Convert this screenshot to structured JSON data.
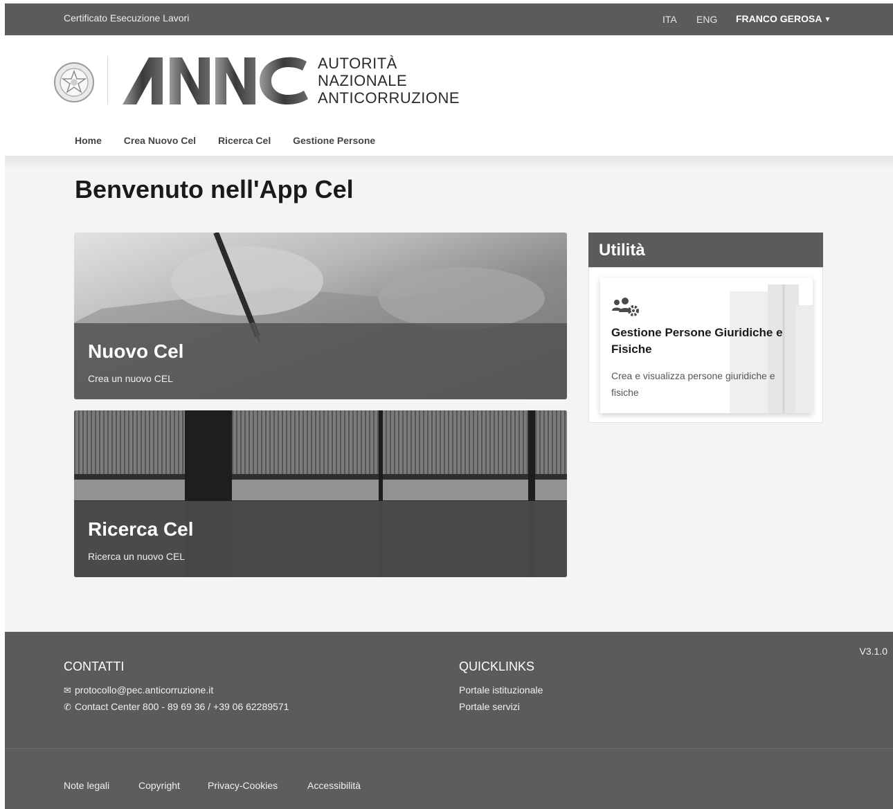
{
  "topbar": {
    "app_name": "Certificato Esecuzione Lavori",
    "lang_ita": "ITA",
    "lang_eng": "ENG",
    "user_name": "FRANCO GEROSA"
  },
  "header": {
    "logo_text": "ANAC",
    "org_line1": "AUTORITÀ",
    "org_line2": "NAZIONALE",
    "org_line3": "ANTICORRUZIONE"
  },
  "nav": {
    "items": [
      {
        "label": "Home"
      },
      {
        "label": "Crea Nuovo Cel"
      },
      {
        "label": "Ricerca Cel"
      },
      {
        "label": "Gestione Persone"
      }
    ]
  },
  "main": {
    "title": "Benvenuto nell'App Cel",
    "cards": [
      {
        "title": "Nuovo Cel",
        "subtitle": "Crea un nuovo CEL"
      },
      {
        "title": "Ricerca Cel",
        "subtitle": "Ricerca un nuovo CEL"
      }
    ]
  },
  "utilita": {
    "heading": "Utilità",
    "card": {
      "icon": "users-gear-icon",
      "title": "Gestione Persone Giuridiche e Fisiche",
      "text": "Crea e visualizza persone giuridiche e fisiche"
    }
  },
  "footer": {
    "version": "V3.1.0",
    "contatti_heading": "CONTATTI",
    "email": "protocollo@pec.anticorruzione.it",
    "phone": "Contact Center 800 - 89 69 36 / +39 06 62289571",
    "quicklinks_heading": "QUICKLINKS",
    "quicklinks": [
      "Portale istituzionale",
      "Portale servizi"
    ],
    "legal_links": [
      "Note legali",
      "Copyright",
      "Privacy-Cookies",
      "Accessibilità"
    ]
  }
}
